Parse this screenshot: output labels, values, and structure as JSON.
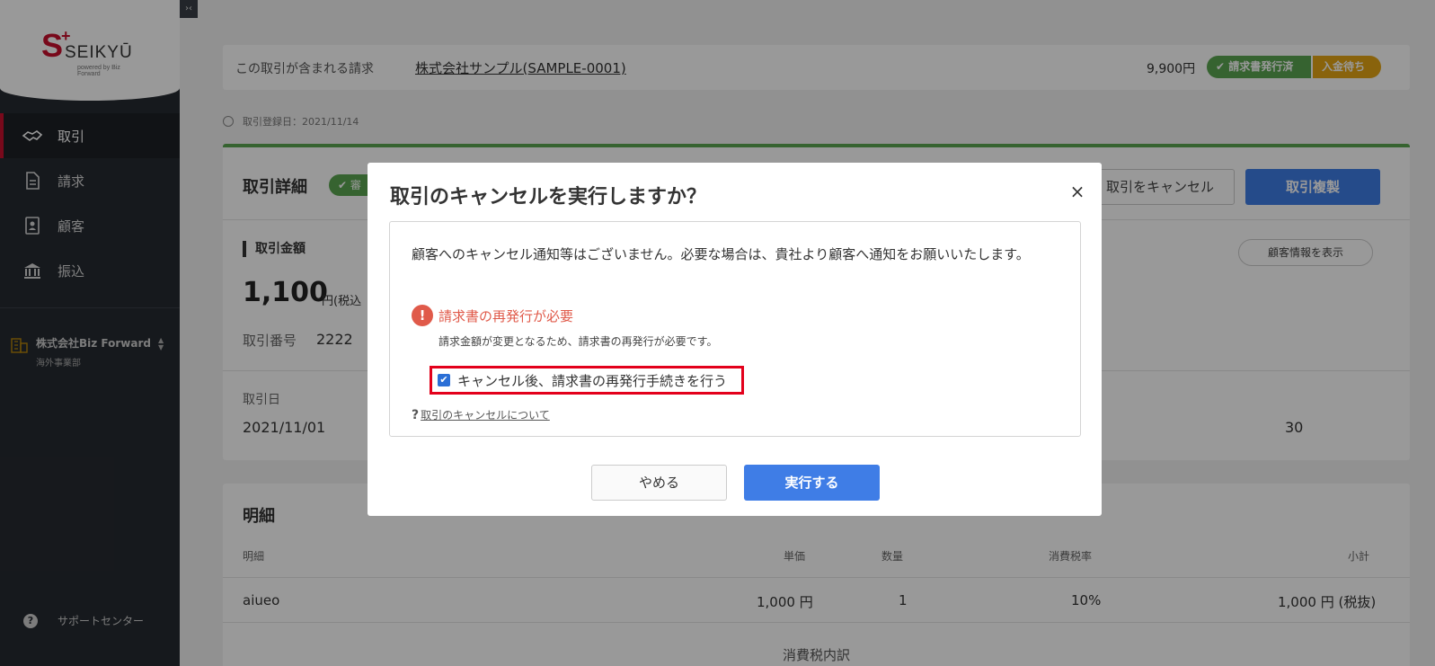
{
  "sidebar": {
    "logo": {
      "mark": "S",
      "plus": "+",
      "text": "SEIKYŪ",
      "sub": "powered by Biz Forward"
    },
    "items": [
      {
        "label": "取引",
        "icon": "handshake-icon",
        "active": true
      },
      {
        "label": "請求",
        "icon": "document-icon",
        "active": false
      },
      {
        "label": "顧客",
        "icon": "contact-card-icon",
        "active": false
      },
      {
        "label": "振込",
        "icon": "bank-icon",
        "active": false
      }
    ],
    "company": {
      "name": "株式会社Biz Forward",
      "dept": "海外事業部"
    },
    "support": "サポートセンター",
    "collapse": "›‹"
  },
  "invoice_bar": {
    "label": "この取引が含まれる請求",
    "link": "株式会社サンプル(SAMPLE-0001)",
    "amount": "9,900円",
    "status_issued": "✔ 請求書発行済",
    "status_payment": "入金待ち"
  },
  "registered_date": "取引登録日：2021/11/14",
  "detail": {
    "title": "取引詳細",
    "approved_badge": "✔ 審",
    "cancel_button": "取引をキャンセル",
    "duplicate_button": "取引複製",
    "amount_label": "取引金額",
    "customer_info_button": "顧客情報を表示",
    "amount_value": "1,100",
    "amount_unit": "円(税込",
    "tx_no_label": "取引番号",
    "tx_no_value": "2222",
    "tx_date_label": "取引日",
    "tx_date_value": "2021/11/01",
    "partial_value": "30"
  },
  "lines": {
    "title": "明細",
    "headers": {
      "item": "明細",
      "unit_price": "単価",
      "qty": "数量",
      "tax_rate": "消費税率",
      "subtotal": "小計"
    },
    "rows": [
      {
        "item": "aiueo",
        "unit_price": "1,000 円",
        "qty": "1",
        "tax_rate": "10%",
        "subtotal": "1,000 円 (税抜)"
      }
    ],
    "tax_breakdown": "消費税内訳"
  },
  "modal": {
    "title": "取引のキャンセルを実行しますか？",
    "close": "×",
    "message": "顧客へのキャンセル通知等はございません。必要な場合は、貴社より顧客へ通知をお願いいたします。",
    "warning_title": "請求書の再発行が必要",
    "warning_desc": "請求金額が変更となるため、請求書の再発行が必要です。",
    "reissue_label": "キャンセル後、請求書の再発行手続きを行う",
    "reissue_checked": true,
    "help_link": "取引のキャンセルについて",
    "stop_button": "やめる",
    "execute_button": "実行する"
  },
  "colors": {
    "brand_red": "#c8102e",
    "sidebar_bg": "#262a31",
    "primary_blue": "#3f7de6",
    "success_green": "#5aa651",
    "warning_yellow": "#e4a614",
    "error_red": "#e05a4a",
    "highlight_red": "#e3001b"
  }
}
